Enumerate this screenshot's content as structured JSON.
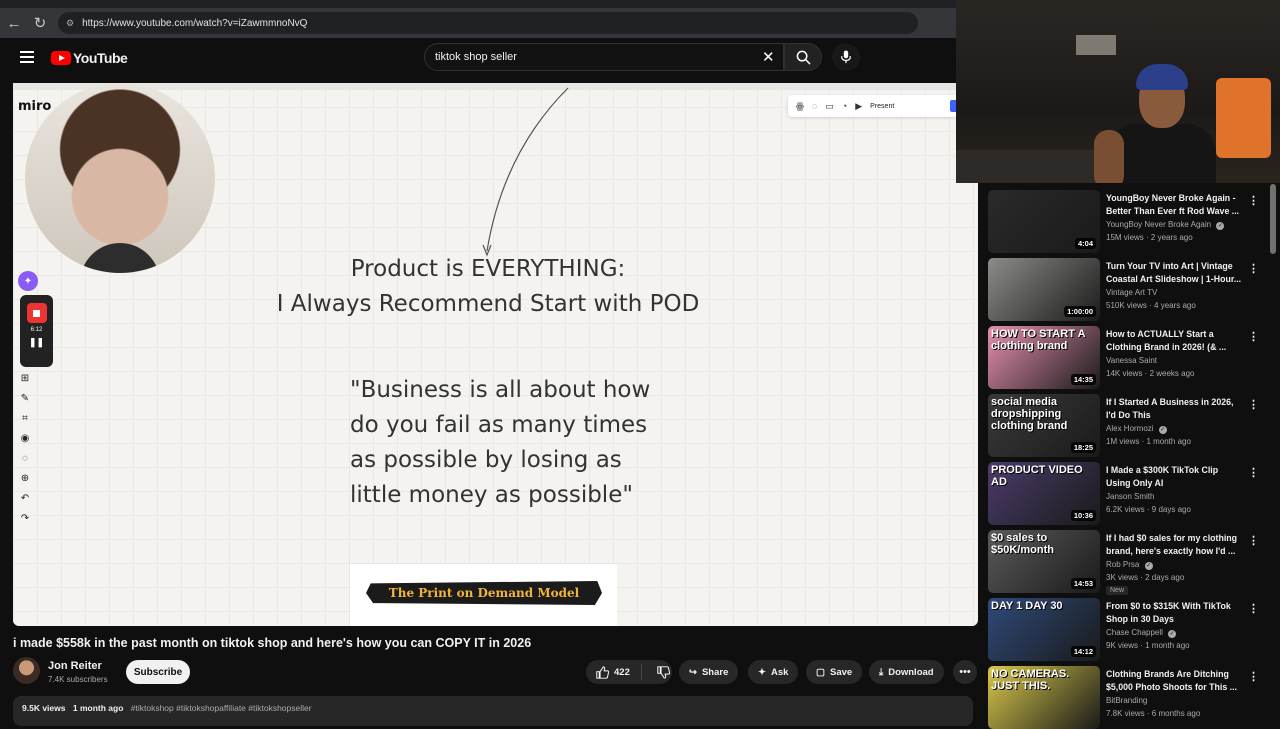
{
  "browser": {
    "url": "https://www.youtube.com/watch?v=iZawmmnoNvQ"
  },
  "header": {
    "logo_text": "YouTube",
    "search_value": "tiktok shop seller"
  },
  "slide": {
    "title_line1": "Product is EVERYTHING:",
    "title_line2": "I Always Recommend Start with POD",
    "quote_line1": "\"Business is all about how",
    "quote_line2": "do you fail as many times",
    "quote_line3": "as possible by losing as",
    "quote_line4": "little money as possible\"",
    "pod_banner": "The Print on Demand Model",
    "miro_logo": "miro",
    "present_label": "Present",
    "rec_time": "6:12"
  },
  "video": {
    "title": "i made $558k in the past month on tiktok shop and here's how you can COPY IT in 2026",
    "channel": "Jon Reiter",
    "subscribers": "7.4K subscribers",
    "subscribe_label": "Subscribe",
    "likes": "422",
    "share_label": "Share",
    "ask_label": "Ask",
    "save_label": "Save",
    "download_label": "Download",
    "views": "9.5K views",
    "age": "1 month ago",
    "tags": "#tiktokshop #tiktokshopaffiliate #tiktokshopseller"
  },
  "recommendations": [
    {
      "title": "YoungBoy Never Broke Again - Better Than Ever ft Rod Wave ...",
      "channel": "YoungBoy Never Broke Again",
      "verified": true,
      "meta": "15M views · 2 years ago",
      "duration": "4:04",
      "thumb_text": "",
      "new": false,
      "color": "#2a2a2a"
    },
    {
      "title": "Turn Your TV into Art | Vintage Coastal Art Slideshow | 1-Hour...",
      "channel": "Vintage Art TV",
      "verified": false,
      "meta": "510K views · 4 years ago",
      "duration": "1:00:00",
      "thumb_text": "",
      "new": false,
      "color": "#8c8d88"
    },
    {
      "title": "How to ACTUALLY Start a Clothing Brand in 2026! (& ...",
      "channel": "Vanessa Saint",
      "verified": false,
      "meta": "14K views · 2 weeks ago",
      "duration": "14:35",
      "thumb_text": "HOW TO START A clothing brand",
      "new": false,
      "color": "#e58fb0"
    },
    {
      "title": "If I Started A Business in 2026, I'd Do This",
      "channel": "Alex Hormozi",
      "verified": true,
      "meta": "1M views · 1 month ago",
      "duration": "18:25",
      "thumb_text": "social media dropshipping clothing brand",
      "new": false,
      "color": "#3a3a3a"
    },
    {
      "title": "I Made a $300K TikTok Clip Using Only AI",
      "channel": "Janson Smith",
      "verified": false,
      "meta": "6.2K views · 9 days ago",
      "duration": "10:36",
      "thumb_text": "PRODUCT   VIDEO AD",
      "new": false,
      "color": "#4b3b6b"
    },
    {
      "title": "If I had $0 sales for my clothing brand, here's exactly how I'd ...",
      "channel": "Rob Prsa",
      "verified": true,
      "meta": "3K views · 2 days ago",
      "duration": "14:53",
      "thumb_text": "$0 sales to $50K/month",
      "new": true,
      "new_label": "New",
      "color": "#5a5a5a"
    },
    {
      "title": "From $0 to $315K With TikTok Shop in 30 Days",
      "channel": "Chase Chappell",
      "verified": true,
      "meta": "9K views · 1 month ago",
      "duration": "14:12",
      "thumb_text": "DAY 1          DAY 30",
      "new": false,
      "color": "#2f4a7a"
    },
    {
      "title": "Clothing Brands Are Ditching $5,000 Photo Shoots for This ...",
      "channel": "BitBranding",
      "verified": false,
      "meta": "7.8K views · 6 months ago",
      "duration": "",
      "thumb_text": "NO CAMERAS. JUST THIS.",
      "new": false,
      "color": "#d9c84a"
    }
  ]
}
